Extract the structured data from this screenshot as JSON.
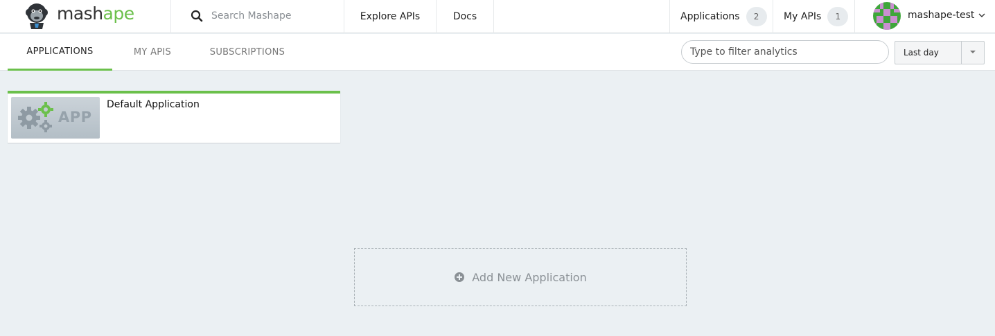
{
  "header": {
    "logo": {
      "part1": "mash",
      "part2": "ape"
    },
    "search": {
      "placeholder": "Search Mashape"
    },
    "nav": {
      "explore": "Explore APIs",
      "docs": "Docs"
    },
    "applications": {
      "label": "Applications",
      "count": "2"
    },
    "my_apis": {
      "label": "My APIs",
      "count": "1"
    },
    "user": {
      "name": "mashape-test"
    }
  },
  "subnav": {
    "tabs": [
      {
        "label": "APPLICATIONS",
        "active": true
      },
      {
        "label": "MY APIS",
        "active": false
      },
      {
        "label": "SUBSCRIPTIONS",
        "active": false
      }
    ],
    "filter": {
      "placeholder": "Type to filter analytics"
    },
    "range": {
      "selected": "Last day"
    }
  },
  "apps": [
    {
      "name": "Default Application",
      "thumb_label": "APP"
    }
  ],
  "add_new": {
    "label": "Add New Application"
  },
  "colors": {
    "brand_green": "#6bc04b",
    "page_bg": "#ebf0f3"
  }
}
